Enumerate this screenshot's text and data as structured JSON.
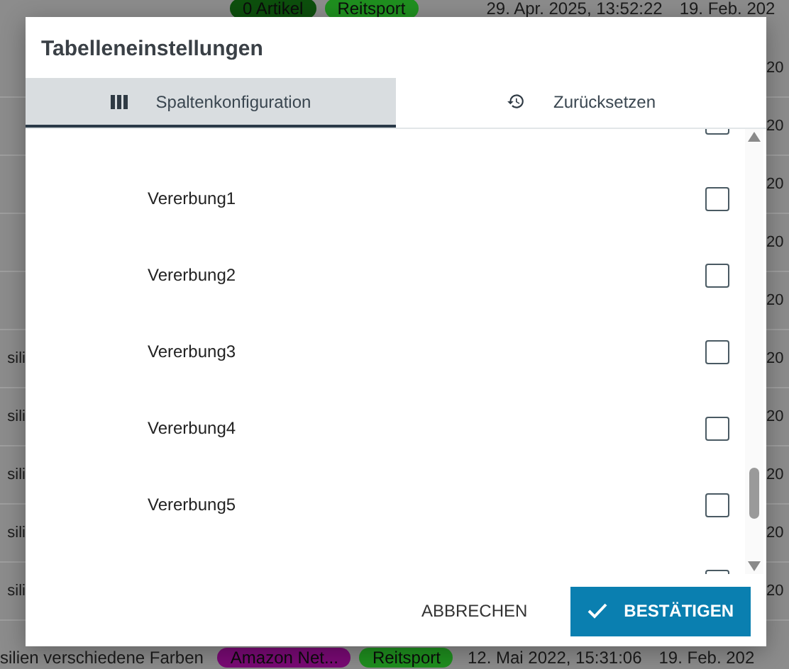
{
  "background_table": {
    "top_row": {
      "tags": [
        {
          "label": "0 Artikel",
          "color": "#0d4f0d"
        },
        {
          "label": "Reitsport",
          "color": "#1f8f1f"
        }
      ],
      "date_1": "29. Apr. 2025, 13:52:22",
      "date_2": "19. Feb. 202"
    },
    "rows": [
      {
        "right_cell": "20"
      },
      {
        "right_cell": "20"
      },
      {
        "right_cell": "20"
      },
      {
        "right_cell": "20"
      },
      {
        "right_cell": "20"
      },
      {
        "left_cell": "sili",
        "right_cell": "20"
      },
      {
        "left_cell": "sili",
        "right_cell": "20"
      },
      {
        "left_cell": "sili",
        "right_cell": "20"
      },
      {
        "left_cell": "sili",
        "right_cell": "20"
      },
      {
        "left_cell": "sili",
        "right_cell": "20"
      }
    ],
    "bottom_row": {
      "name": "silien verschiedene Farben",
      "tags": [
        {
          "label": "Amazon Net...",
          "color": "#7a0a75"
        },
        {
          "label": "Reitsport",
          "color": "#1f8f1f"
        }
      ],
      "date_1": "12. Mai 2022, 15:31:06",
      "date_2": "19. Feb. 202"
    }
  },
  "dialog": {
    "title": "Tabelleneinstellungen",
    "tabs": [
      {
        "label": "Spaltenkonfiguration",
        "kind": "columns",
        "selected": true
      },
      {
        "label": "Zurücksetzen",
        "kind": "history",
        "selected": false
      }
    ],
    "items": [
      {
        "checked": false
      },
      {
        "label": "Vererbung1",
        "checked": false
      },
      {
        "label": "Vererbung2",
        "checked": false
      },
      {
        "label": "Vererbung3",
        "checked": false
      },
      {
        "label": "Vererbung4",
        "checked": false
      },
      {
        "label": "Vererbung5",
        "checked": false
      },
      {
        "checked": false
      }
    ],
    "buttons": [
      {
        "label": "ABBRECHEN",
        "kind": "text"
      },
      {
        "label": "BESTÄTIGEN",
        "kind": "primary"
      }
    ]
  }
}
